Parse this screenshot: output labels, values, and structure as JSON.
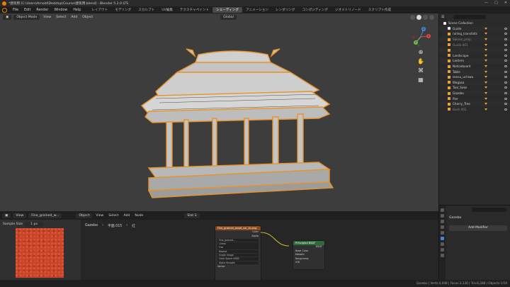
{
  "window": {
    "title": "*建筑用 [C:\\Users\\Arnold\\Desktop\\Course\\建筑用.blend] - Blender 5.2.0 LTS",
    "controls": [
      "—",
      "□",
      "✕"
    ]
  },
  "menu": {
    "items": [
      "File",
      "Edit",
      "Render",
      "Window",
      "Help"
    ]
  },
  "workspaces": {
    "tabs": [
      "レイアウト",
      "モデリング",
      "スカルプト",
      "UV編集",
      "テクスチャペイント",
      "シェーディング",
      "アニメーション",
      "レンダリング",
      "コンポジティング",
      "ジオメトリノード",
      "スクリプト作成"
    ],
    "active_index": 5
  },
  "topbar": {
    "scene": "Scene",
    "view_layer": "ViewLayer"
  },
  "viewport": {
    "mode": "Object Mode",
    "menus": [
      "View",
      "Select",
      "Add",
      "Object"
    ],
    "transform": "Global",
    "gizmo_axes": [
      "X",
      "Y",
      "Z"
    ]
  },
  "outliner": {
    "root": "Scene Collection",
    "items": [
      {
        "name": "Guide",
        "icon": "collection-icon"
      },
      {
        "name": "railing_transfalts",
        "icon": "mesh-icon"
      },
      {
        "name": "Saloon_prop",
        "icon": "mesh-icon",
        "dim": true
      },
      {
        "name": "Guide.001",
        "icon": "mesh-icon",
        "dim": true
      },
      {
        "name": "",
        "icon": "mesh-icon"
      },
      {
        "name": "Landscape",
        "icon": "mesh-icon"
      },
      {
        "name": "Lantern",
        "icon": "mesh-icon"
      },
      {
        "name": "Noticeboard",
        "icon": "mesh-icon"
      },
      {
        "name": "Table",
        "icon": "mesh-icon"
      },
      {
        "name": "sensu_uchiwa",
        "icon": "mesh-icon"
      },
      {
        "name": "Wagasa",
        "icon": "mesh-icon"
      },
      {
        "name": "Tool_Sake",
        "icon": "mesh-icon"
      },
      {
        "name": "Gazebo",
        "icon": "mesh-icon"
      },
      {
        "name": "Pier",
        "icon": "mesh-icon"
      },
      {
        "name": "Cherry_Tree",
        "icon": "mesh-icon"
      },
      {
        "name": "Bush.001",
        "icon": "mesh-icon",
        "dim": true
      }
    ]
  },
  "node_editor": {
    "editor_menu": "View",
    "image_name": "Fine_grained_w...",
    "object_menu": "Object",
    "menus": [
      "View",
      "Select",
      "Add",
      "Node"
    ],
    "slot": "Slot 3",
    "sample_size_label": "Sample Size",
    "sample_size_value": "1 px",
    "breadcrumb": [
      "Gazebo",
      "平面.015",
      "红"
    ],
    "nodes": {
      "image_texture": {
        "title": "Fine_grained_wood_col_1k.png",
        "rows": [
          "Color",
          "Alpha"
        ],
        "image": "Fine_grained...",
        "fields": [
          "Linear",
          "Flat",
          "Repeat",
          "Single Image",
          "Color Space  sRGB",
          "Alpha  Straight"
        ],
        "input": "Vector"
      },
      "principled": {
        "title": "Principled BSDF",
        "output": "BSDF",
        "rows": [
          "Base Color",
          "Metallic",
          "Roughness",
          "IOR",
          "Alpha",
          "Normal"
        ]
      }
    }
  },
  "properties": {
    "object": "Gazebo",
    "add_modifier": "Add Modifier"
  },
  "status": {
    "text": "Gazebo | Verts:4,048 | Faces:3,130 | Tris:6,288 | Objects:1/19"
  }
}
